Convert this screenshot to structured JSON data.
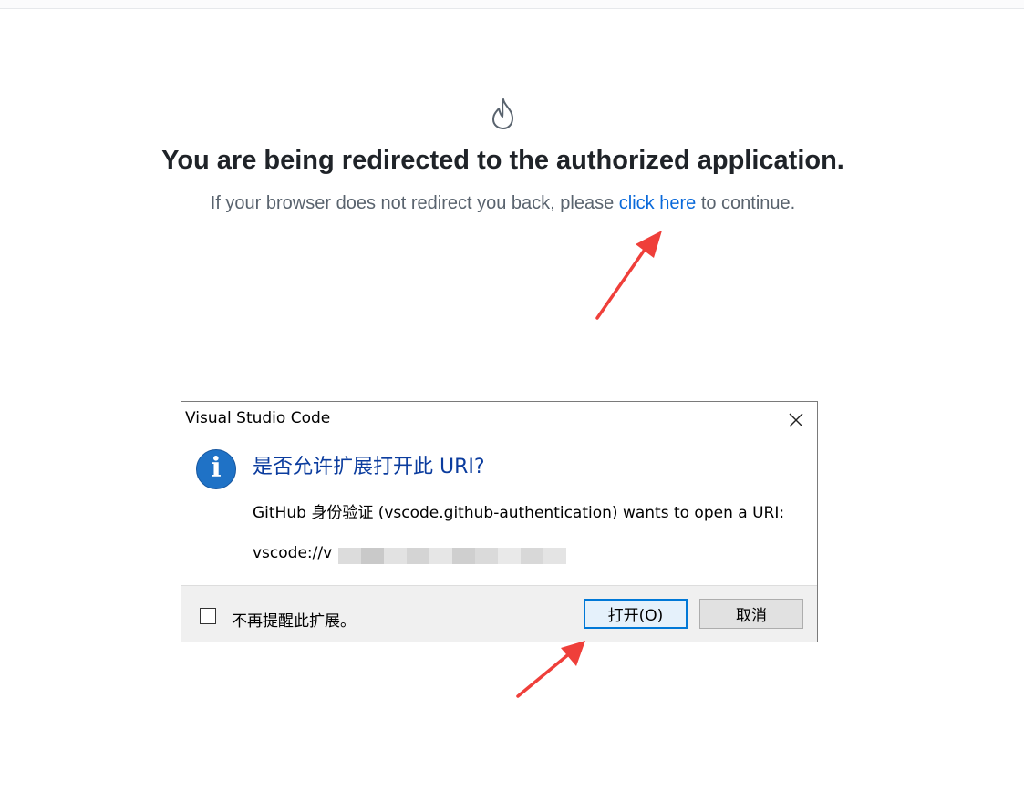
{
  "page": {
    "heading": "You are being redirected to the authorized application.",
    "subtext_before": "If your browser does not redirect you back, please ",
    "link_text": "click here",
    "subtext_after": " to continue."
  },
  "dialog": {
    "title": "Visual Studio Code",
    "heading": "是否允许扩展打开此 URI?",
    "body": "GitHub 身份验证 (vscode.github-authentication) wants to open a URI:",
    "uri_prefix": "vscode://v",
    "checkbox_label": "不再提醒此扩展。",
    "checkbox_checked": false,
    "open_button": "打开(O)",
    "cancel_button": "取消"
  },
  "colors": {
    "link": "#0969da",
    "annotation_arrow": "#ef3f3a",
    "info_icon": "#1f72c6",
    "dialog_heading": "#0b3c9e"
  },
  "icons": [
    "flame-icon",
    "close-icon",
    "info-icon",
    "annotation-arrow"
  ]
}
